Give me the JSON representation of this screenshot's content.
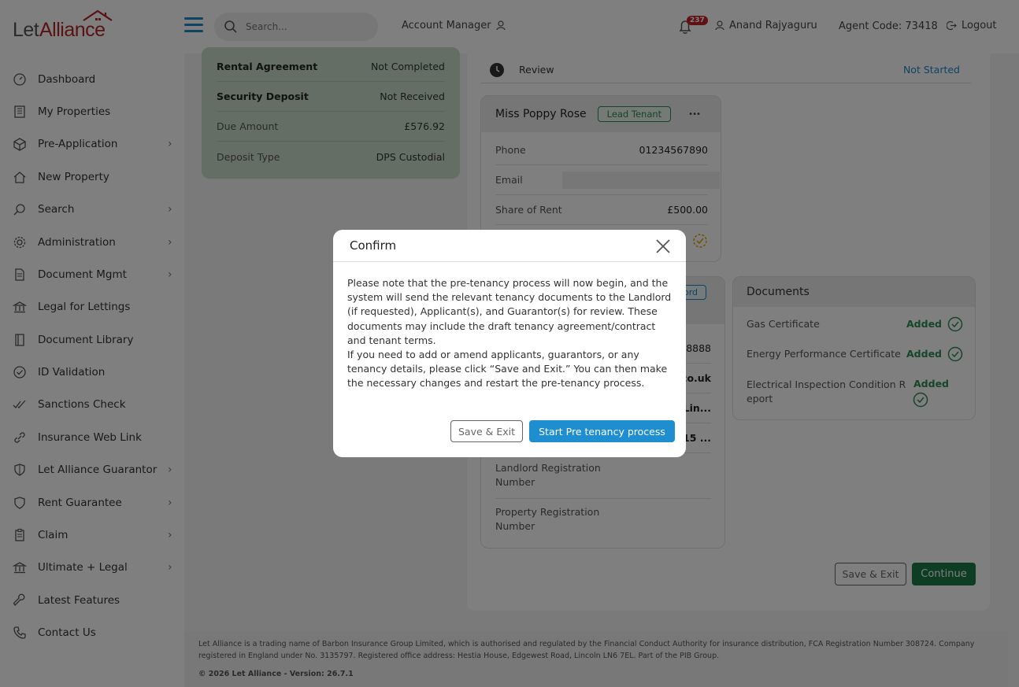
{
  "header": {
    "logo_let": "Let",
    "logo_alliance": "Alliance",
    "search_placeholder": "Search...",
    "account_manager": "Account Manager",
    "notification_count": "237",
    "user_name": "Anand Rajyaguru",
    "agent_code": "Agent Code: 73418",
    "logout": "Logout"
  },
  "sidebar": {
    "items": [
      {
        "label": "Dashboard",
        "icon": "dashboard-icon",
        "chevron": false
      },
      {
        "label": "My Properties",
        "icon": "building-icon",
        "chevron": false
      },
      {
        "label": "Pre-Application",
        "icon": "box-icon",
        "chevron": true
      },
      {
        "label": "New Property",
        "icon": "home-icon",
        "chevron": false
      },
      {
        "label": "Search",
        "icon": "search-icon",
        "chevron": true
      },
      {
        "label": "Administration",
        "icon": "gear-icon",
        "chevron": true
      },
      {
        "label": "Document Mgmt",
        "icon": "document-icon",
        "chevron": true
      },
      {
        "label": "Legal for Lettings",
        "icon": "bank-icon",
        "chevron": false
      },
      {
        "label": "Document Library",
        "icon": "book-icon",
        "chevron": false
      },
      {
        "label": "ID Validation",
        "icon": "check-circle-icon",
        "chevron": false
      },
      {
        "label": "Sanctions Check",
        "icon": "double-check-icon",
        "chevron": false
      },
      {
        "label": "Insurance Web Link",
        "icon": "link-icon",
        "chevron": false
      },
      {
        "label": "Let Alliance Guarantor",
        "icon": "shield-icon",
        "chevron": true
      },
      {
        "label": "Rent Guarantee",
        "icon": "shield-outline-icon",
        "chevron": true
      },
      {
        "label": "Claim",
        "icon": "clipboard-icon",
        "chevron": true
      },
      {
        "label": "Ultimate + Legal",
        "icon": "bank-icon",
        "chevron": true
      },
      {
        "label": "Latest Features",
        "icon": "wrench-icon",
        "chevron": false
      },
      {
        "label": "Contact Us",
        "icon": "phone-icon",
        "chevron": false
      }
    ]
  },
  "summary": {
    "rows": [
      {
        "label": "Rental Agreement",
        "value": "Not Completed",
        "bold": true
      },
      {
        "label": "Security Deposit",
        "value": "Not Received",
        "bold": true
      },
      {
        "label": "Due Amount",
        "value": "£576.92",
        "bold": false
      },
      {
        "label": "Deposit Type",
        "value": "DPS Custodial",
        "bold": false
      }
    ]
  },
  "review": {
    "label": "Review",
    "status": "Not Started"
  },
  "tenant": {
    "name": "Miss Poppy Rose",
    "badge": "Lead Tenant",
    "more": "•••",
    "phone_label": "Phone",
    "phone": "01234567890",
    "email_label": "Email",
    "share_label": "Share of Rent",
    "share": "£500.00"
  },
  "landlord": {
    "badge_partial": "ord",
    "phone_partial": "8888",
    "email_partial": "co.uk",
    "addr1_partial": "s Lin...",
    "addr2_partial": "15 ...",
    "reg_label": "Landlord Registration Number",
    "prop_reg_label": "Property Registration Number"
  },
  "documents": {
    "title": "Documents",
    "items": [
      {
        "label": "Gas Certificate",
        "status": "Added"
      },
      {
        "label": "Energy Performance Certificate",
        "status": "Added"
      },
      {
        "label": "Electrical Inspection Condition Report",
        "status": "Added"
      }
    ]
  },
  "actions": {
    "save_exit": "Save & Exit",
    "continue": "Continue"
  },
  "footer": {
    "legal": "Let Alliance is a trading name of Barbon Insurance Group Limited, which is authorised and regulated by the Financial Conduct Authority for insurance distribution, FCA Registration Number 308724. Company registered in England under No. 3135797. Registered office address: Hestia House, Edgewest Road, Lincoln LN6 7EL. Part of the PIB Group.",
    "version": "© 2026 Let Alliance - Version: 26.7.1"
  },
  "modal": {
    "title": "Confirm",
    "paragraph1": "Please note that the pre-tenancy process will now begin, and the system will send the relevant tenancy documents to the Landlord (if requested), Applicant(s), and Guarantor(s) for review. These documents may include the draft tenancy agreement/contract and tenant terms.",
    "paragraph2": "If you need to add or amend applicants, guarantors, or any tenancy details, please click “Save and Exit.” You can then make the necessary changes and restart the pre-tenancy process.",
    "save_exit": "Save & Exit",
    "start": "Start Pre tenancy process"
  },
  "colors": {
    "brand_red": "#b3262b",
    "accent_blue": "#1e8ed0",
    "success_green": "#1b7a46",
    "card_green": "#c9dccb"
  }
}
